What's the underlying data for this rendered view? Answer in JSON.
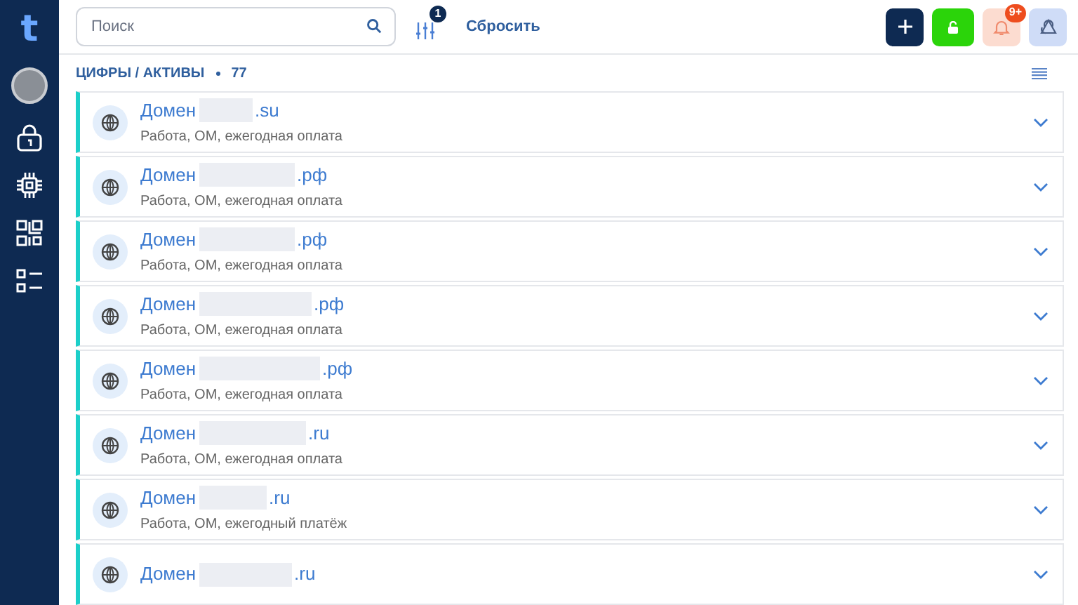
{
  "sidebar": {
    "items": [
      {
        "kind": "logo",
        "label": "t"
      },
      {
        "kind": "avatar"
      },
      {
        "kind": "lock"
      },
      {
        "kind": "chip"
      },
      {
        "kind": "qr"
      },
      {
        "kind": "list"
      }
    ]
  },
  "search": {
    "placeholder": "Поиск"
  },
  "filter": {
    "badge": "1"
  },
  "reset_button": {
    "label": "Сбросить"
  },
  "notifications": {
    "badge": "9+"
  },
  "breadcrumb": {
    "path": "ЦИФРЫ / АКТИВЫ",
    "count": "77"
  },
  "assets": [
    {
      "prefix": "Домен",
      "suffix": ".su",
      "subtitle": "Работа, ОМ, ежегодная оплата",
      "expanded": false
    },
    {
      "prefix": "Домен",
      "suffix": ".рф",
      "subtitle": "Работа, ОМ, ежегодная оплата",
      "expanded": false
    },
    {
      "prefix": "Домен",
      "suffix": ".рф",
      "subtitle": "Работа, ОМ, ежегодная оплата",
      "expanded": false
    },
    {
      "prefix": "Домен",
      "suffix": ".рф",
      "subtitle": "Работа, ОМ, ежегодная оплата",
      "expanded": false
    },
    {
      "prefix": "Домен",
      "suffix": ".рф",
      "subtitle": "Работа, ОМ, ежегодная оплата",
      "expanded": false
    },
    {
      "prefix": "Домен",
      "suffix": ".ru",
      "subtitle": "Работа, ОМ, ежегодная оплата",
      "expanded": false
    },
    {
      "prefix": "Домен",
      "suffix": ".ru",
      "subtitle": "Работа, ОМ, ежегодный платёж",
      "expanded": false
    },
    {
      "prefix": "Домен",
      "suffix": ".ru",
      "expanded": false
    }
  ]
}
